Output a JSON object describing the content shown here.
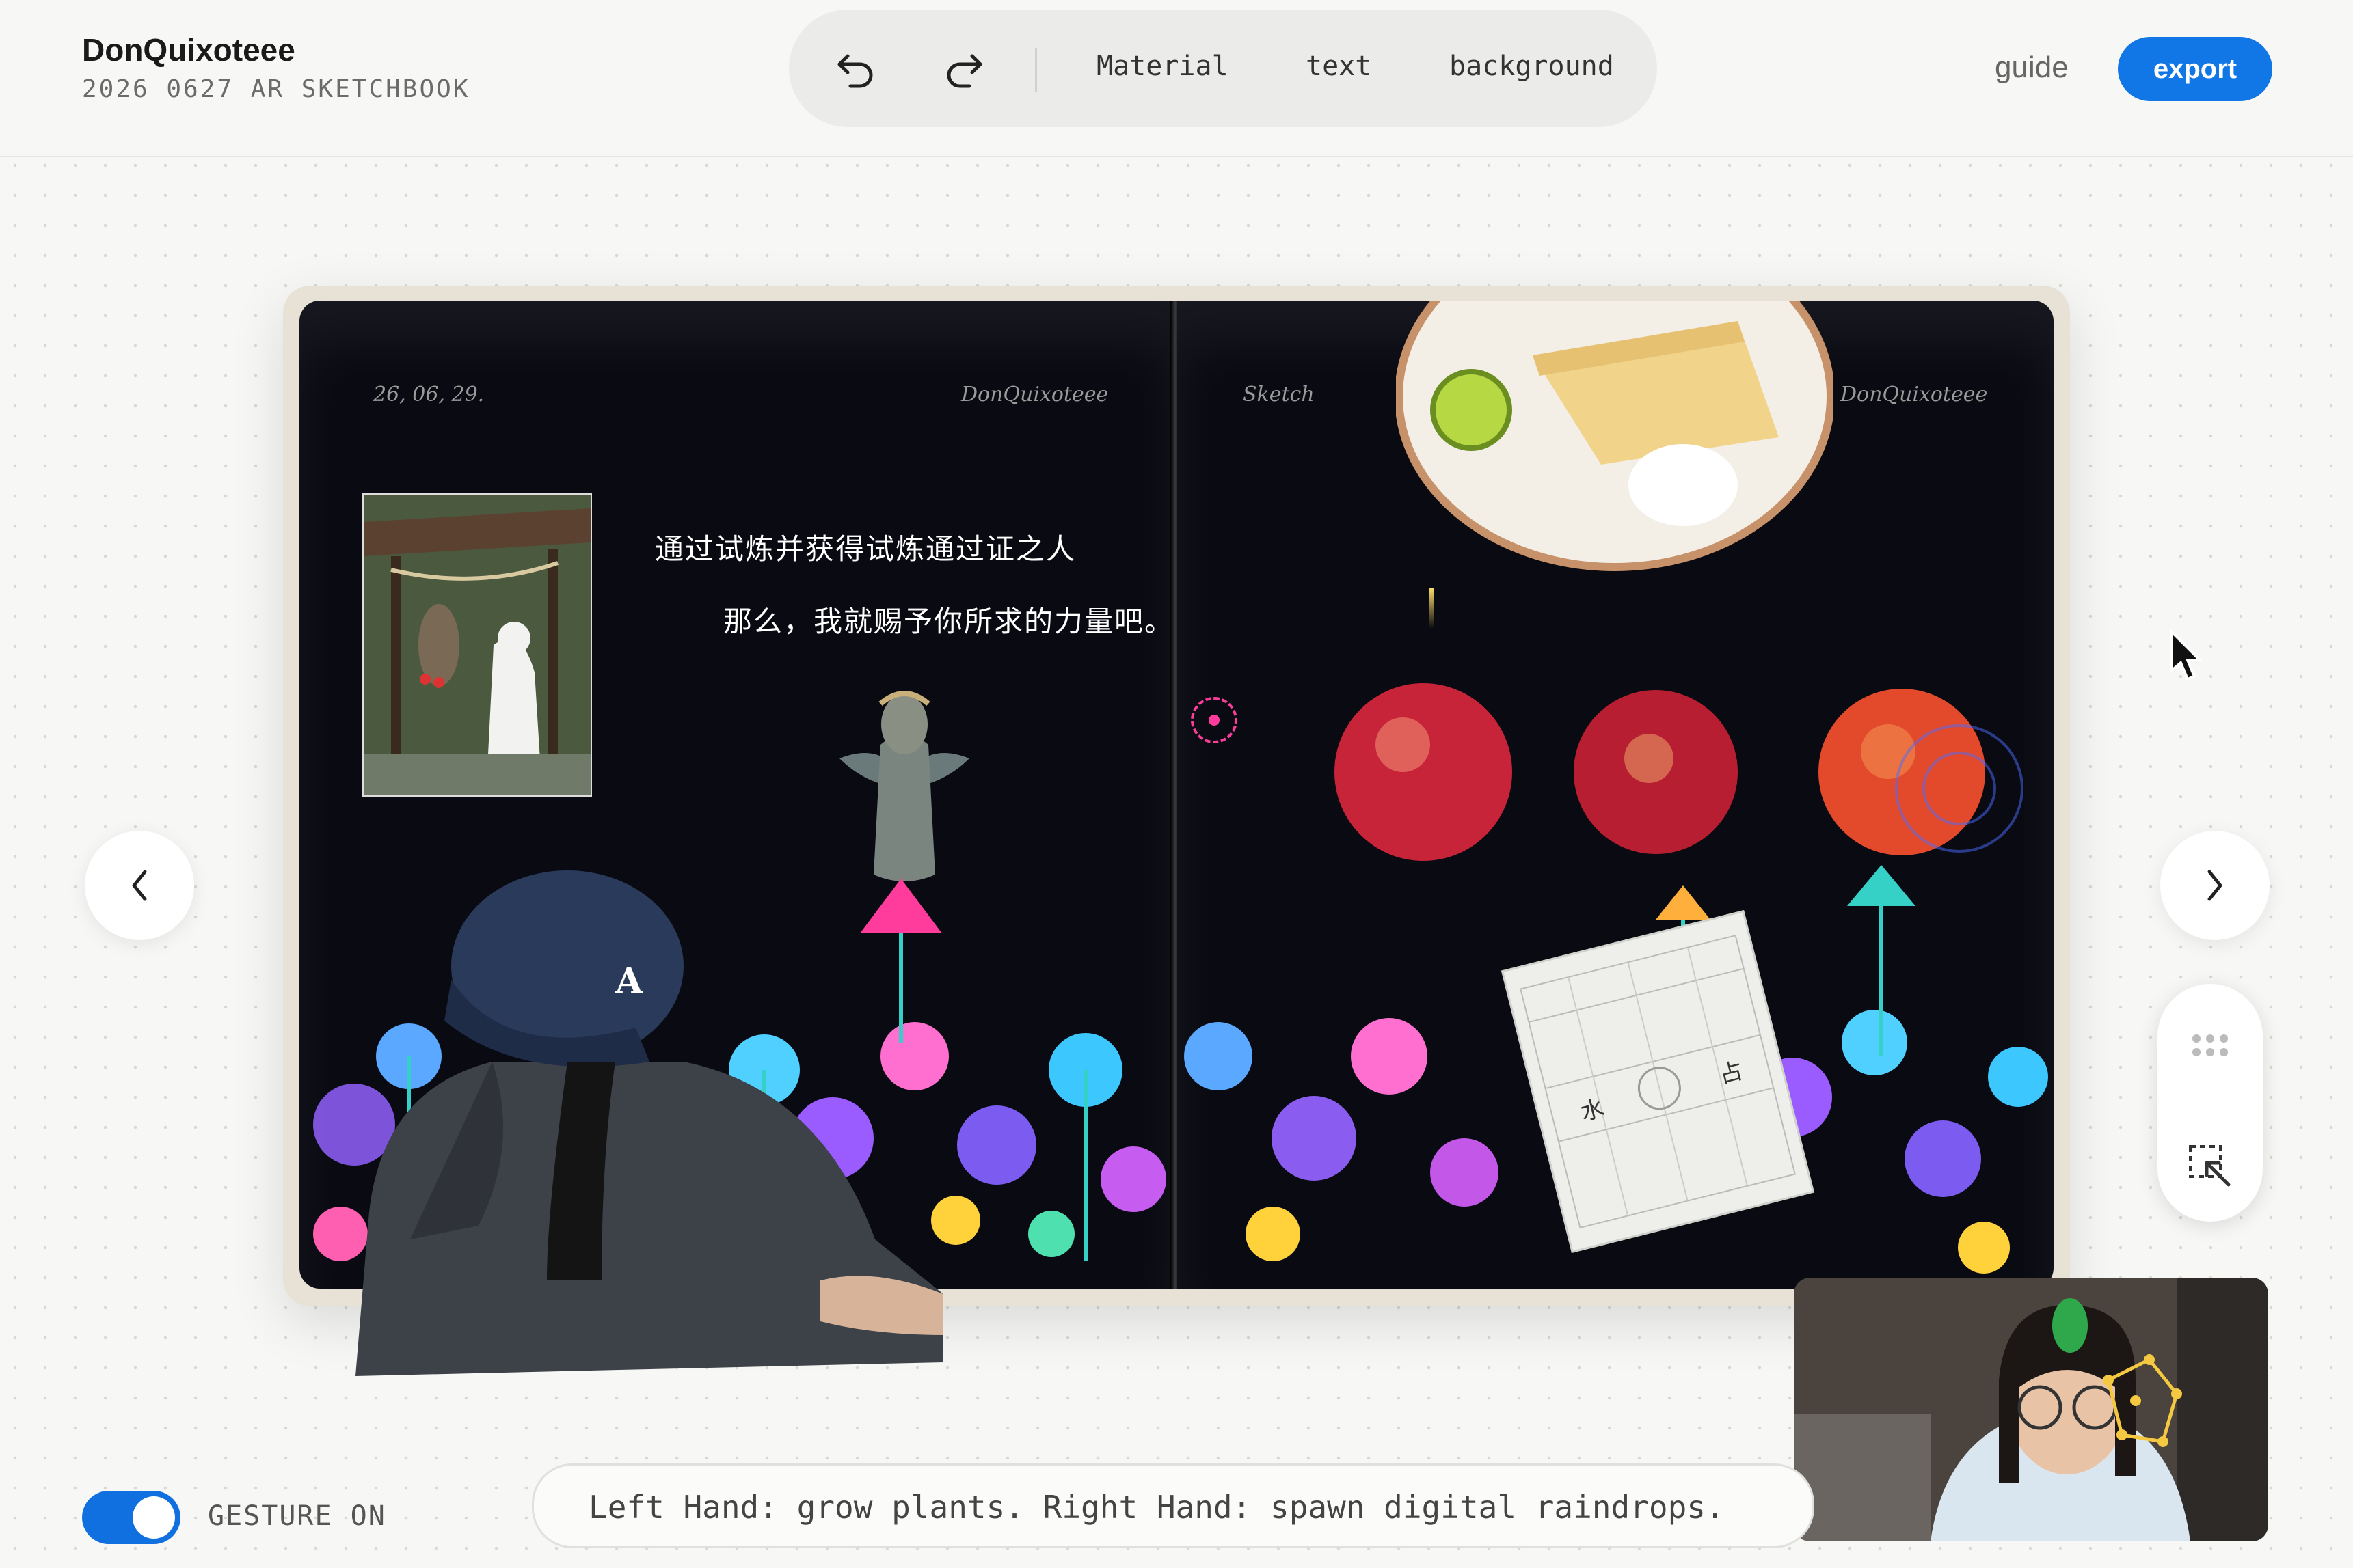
{
  "header": {
    "title": "DonQuixoteee",
    "subtitle": "2026 0627 AR SKETCHBOOK",
    "undo_icon": "undo-icon",
    "redo_icon": "redo-icon",
    "tools": [
      {
        "label": "Material"
      },
      {
        "label": "text"
      },
      {
        "label": "background"
      }
    ],
    "guide_label": "guide",
    "export_label": "export",
    "accent_color": "#1177e6"
  },
  "book": {
    "left_page": {
      "date": "26, 06, 29.",
      "author": "DonQuixoteee",
      "lines": [
        "通过试炼并获得试炼通过证之人",
        "那么，我就赐予你所求的力量吧。"
      ]
    },
    "right_page": {
      "heading": "Sketch",
      "author": "DonQuixoteee",
      "card_chars": [
        "水",
        "占"
      ]
    }
  },
  "nav": {
    "prev_icon": "chevron-left-icon",
    "next_icon": "chevron-right-icon"
  },
  "side_panel": {
    "grip_icon": "grip-dots-icon",
    "select_icon": "select-cursor-icon"
  },
  "footer": {
    "gesture_label": "GESTURE ON",
    "gesture_enabled": true,
    "hint": "Left Hand: grow plants. Right Hand: spawn digital raindrops."
  }
}
